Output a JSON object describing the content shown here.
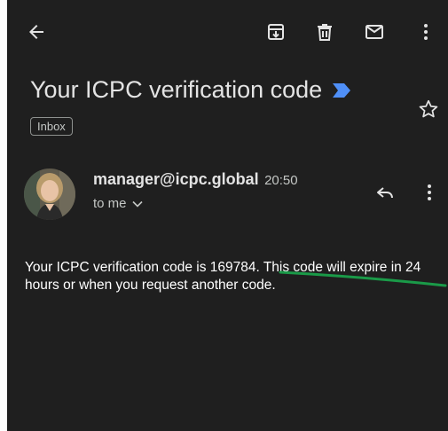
{
  "toolbar": {
    "back_icon": "arrow-left-icon",
    "archive_icon": "archive-icon",
    "delete_icon": "trash-icon",
    "mark_unread_icon": "mail-icon",
    "more_icon": "more-vertical-icon"
  },
  "email": {
    "subject": "Your ICPC verification code",
    "label": "Inbox",
    "sender_name": "manager@icpc.global",
    "time": "20:50",
    "recipient": "to me",
    "body": "Your ICPC verification code is 169784. This code will expire in 24 hours or when you request another code."
  },
  "colors": {
    "background": "#1f1f1f",
    "text": "#e3e3e3",
    "important_marker": "#4f8ff7",
    "annotation_line": "#1a9a48"
  }
}
